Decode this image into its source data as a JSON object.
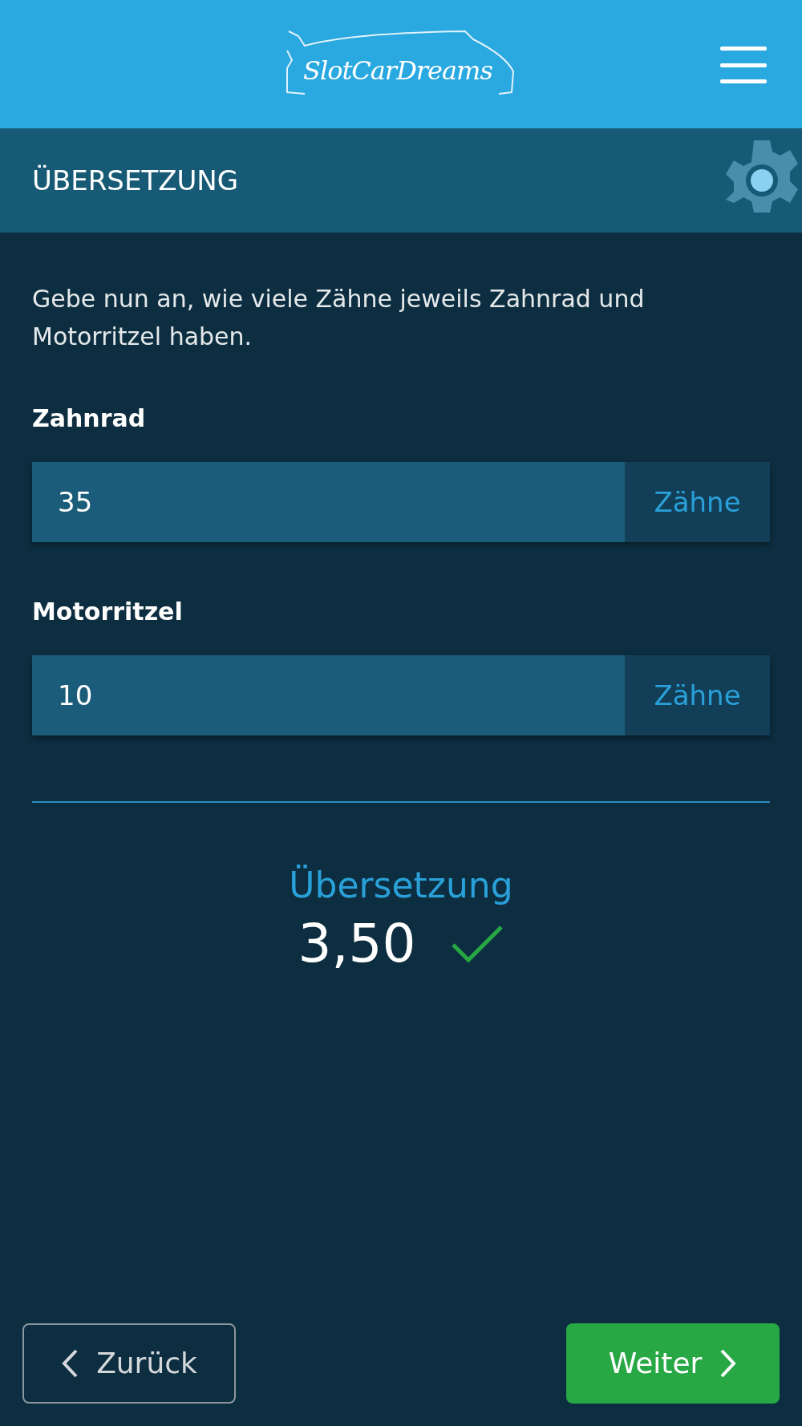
{
  "header": {
    "logo": "SlotCarDreams"
  },
  "section": {
    "title": "ÜBERSETZUNG"
  },
  "intro": "Gebe nun an, wie viele Zähne jeweils Zahnrad und Motorritzel haben.",
  "fields": [
    {
      "label": "Zahnrad",
      "value": "35",
      "unit": "Zähne"
    },
    {
      "label": "Motorritzel",
      "value": "10",
      "unit": "Zähne"
    }
  ],
  "result": {
    "label": "Übersetzung",
    "value": "3,50",
    "valid": true
  },
  "buttons": [
    {
      "label": "Zurück",
      "kind": "back"
    },
    {
      "label": "Weiter",
      "kind": "next"
    }
  ]
}
